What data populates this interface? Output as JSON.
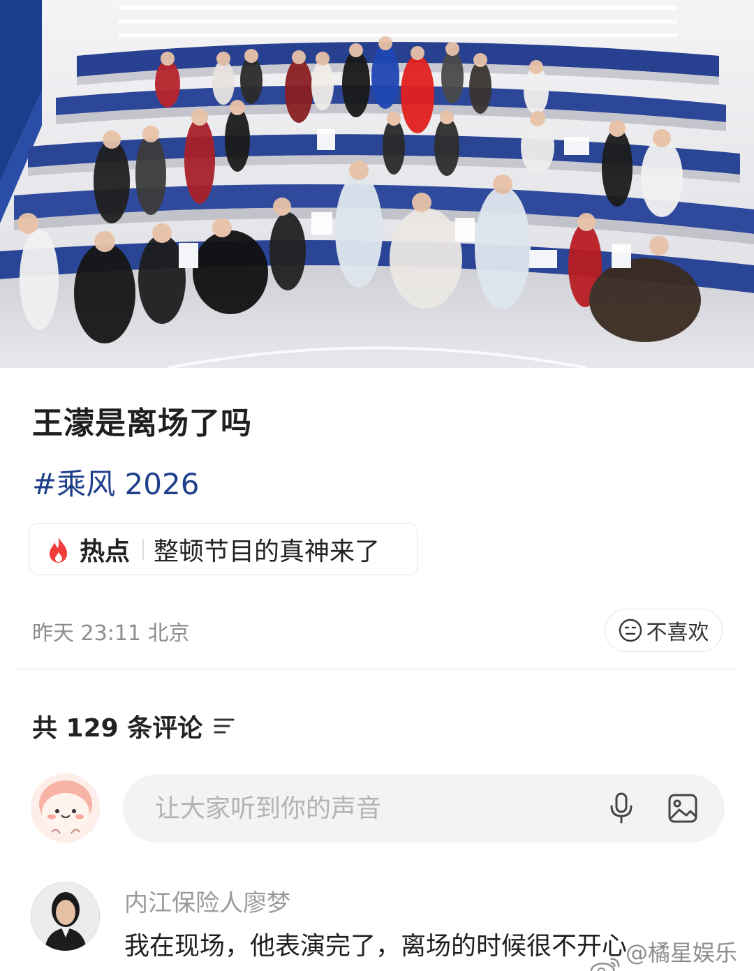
{
  "post": {
    "title": "王濛是离场了吗",
    "topic": "#乘风 2026",
    "hot": {
      "label": "热点",
      "text": "整顿节目的真神来了"
    },
    "meta": "昨天 23:11 北京",
    "dislike_label": "不喜欢"
  },
  "comments": {
    "header": "共 129 条评论",
    "composer_placeholder": "让大家听到你的声音",
    "items": [
      {
        "author": "内江保险人廖梦",
        "text": "我在现场，他表演完了，离场的时候很不开心"
      }
    ]
  },
  "watermark": "@橘星娱乐馆",
  "icons": {
    "hot": "flame-icon",
    "dislike": "neutral-face-icon",
    "sort": "sort-icon",
    "mic": "microphone-icon",
    "image": "image-icon",
    "watermark": "weibo-logo"
  },
  "colors": {
    "topic": "#1e3f8a",
    "hot_flame": "#f23b3b",
    "muted_text": "#8d8d8d",
    "composer_bg": "#f3f3f5"
  }
}
